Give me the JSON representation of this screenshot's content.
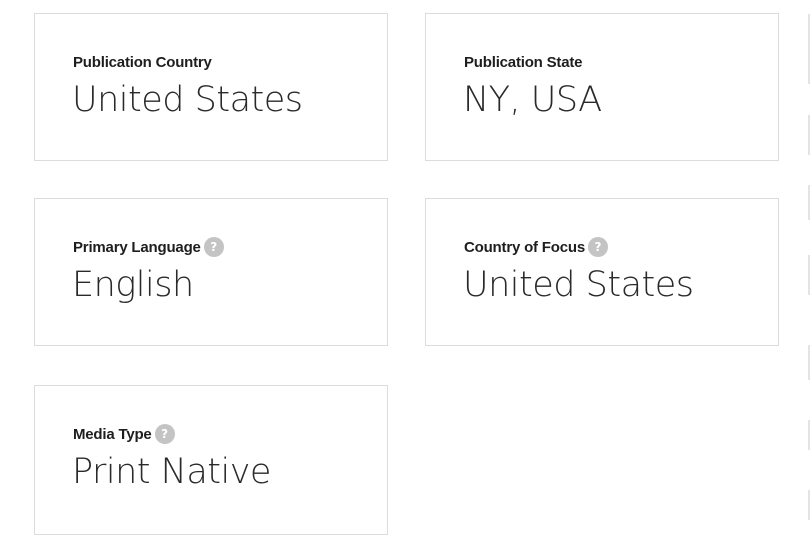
{
  "cards": [
    {
      "label": "Publication Country",
      "value": "United States",
      "has_help": false
    },
    {
      "label": "Publication State",
      "value": "NY, USA",
      "has_help": false
    },
    {
      "label": "Primary Language",
      "value": "English",
      "has_help": true
    },
    {
      "label": "Country of Focus",
      "value": "United States",
      "has_help": true
    },
    {
      "label": "Media Type",
      "value": "Print Native",
      "has_help": true
    }
  ],
  "help_icon": {
    "glyph": "?",
    "name": "question-mark-icon"
  },
  "colors": {
    "card_border": "#dcdcdc",
    "help_icon_bg": "#c4c4c4",
    "text": "#1e1e1e"
  }
}
